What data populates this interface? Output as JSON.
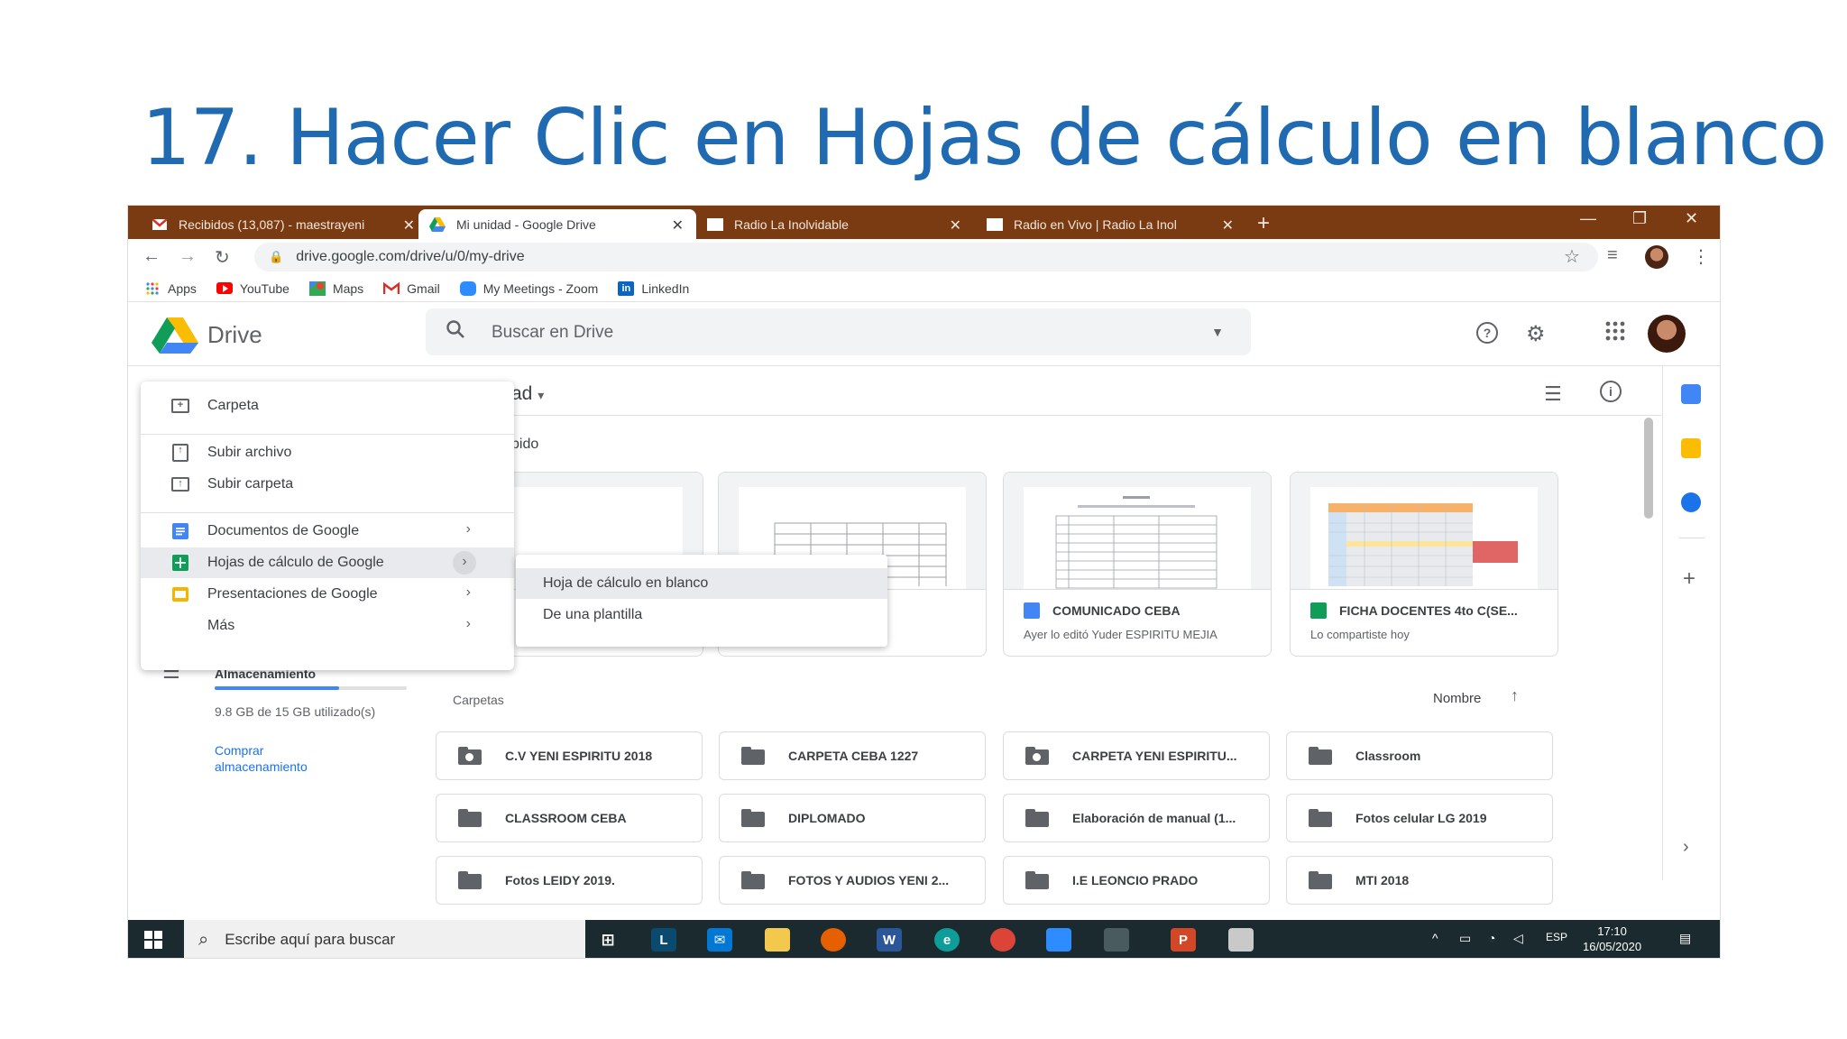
{
  "slide": {
    "title": "17. Hacer Clic en Hojas de cálculo en blanco"
  },
  "browser": {
    "tabs": [
      {
        "label": "Recibidos (13,087) - maestrayeni",
        "icon": "gmail-icon"
      },
      {
        "label": "Mi unidad - Google Drive",
        "icon": "drive-icon"
      },
      {
        "label": "Radio La Inolvidable",
        "icon": "page-icon"
      },
      {
        "label": "Radio en Vivo | Radio La Inol",
        "icon": "page-icon"
      }
    ],
    "url": "drive.google.com/drive/u/0/my-drive",
    "bookmarks": [
      {
        "label": "Apps",
        "icon": "apps-grid-icon"
      },
      {
        "label": "YouTube",
        "icon": "youtube-icon"
      },
      {
        "label": "Maps",
        "icon": "maps-icon"
      },
      {
        "label": "Gmail",
        "icon": "gmail-icon"
      },
      {
        "label": "My Meetings - Zoom",
        "icon": "zoom-icon"
      },
      {
        "label": "LinkedIn",
        "icon": "linkedin-icon"
      }
    ]
  },
  "drive": {
    "app_name": "Drive",
    "search_placeholder": "Buscar en Drive",
    "location_partial": "ad",
    "quick_access_partial": "pido",
    "cards": [
      {
        "title": "",
        "subtitle": ""
      },
      {
        "title": "",
        "subtitle": ""
      },
      {
        "title": "COMUNICADO CEBA",
        "subtitle": "Ayer lo editó Yuder ESPIRITU MEJIA"
      },
      {
        "title": "FICHA DOCENTES 4to C(SE...",
        "subtitle": "Lo compartiste hoy"
      }
    ],
    "folders_label": "Carpetas",
    "sort_label": "Nombre",
    "folders": [
      "C.V YENI ESPIRITU 2018",
      "CARPETA CEBA 1227",
      "CARPETA YENI ESPIRITU...",
      "Classroom",
      "CLASSROOM CEBA",
      "DIPLOMADO",
      "Elaboración de manual (1...",
      "Fotos celular LG 2019",
      "Fotos LEIDY 2019.",
      "FOTOS Y AUDIOS YENI 2...",
      "I.E LEONCIO PRADO",
      "MTI 2018"
    ],
    "storage": {
      "label": "Almacenamiento",
      "used_text": "9.8 GB de 15 GB utilizado(s)",
      "used_fraction": 0.65,
      "buy_label": "Comprar almacenamiento"
    }
  },
  "new_menu": {
    "folder": "Carpeta",
    "upload_file": "Subir archivo",
    "upload_folder": "Subir carpeta",
    "docs": "Documentos de Google",
    "sheets": "Hojas de cálculo de Google",
    "slides": "Presentaciones de Google",
    "more": "Más"
  },
  "submenu": {
    "blank": "Hoja de cálculo en blanco",
    "template": "De una plantilla"
  },
  "taskbar": {
    "search_placeholder": "Escribe aquí para buscar",
    "lang": "ESP",
    "time": "17:10",
    "date": "16/05/2020"
  },
  "colors": {
    "slide_title": "#1f6ab0",
    "tab_strip": "#7b3b12",
    "sheets_green": "#0f9d58",
    "docs_blue": "#4285f4",
    "slides_yellow": "#f4b400",
    "link_blue": "#1a73e8"
  }
}
